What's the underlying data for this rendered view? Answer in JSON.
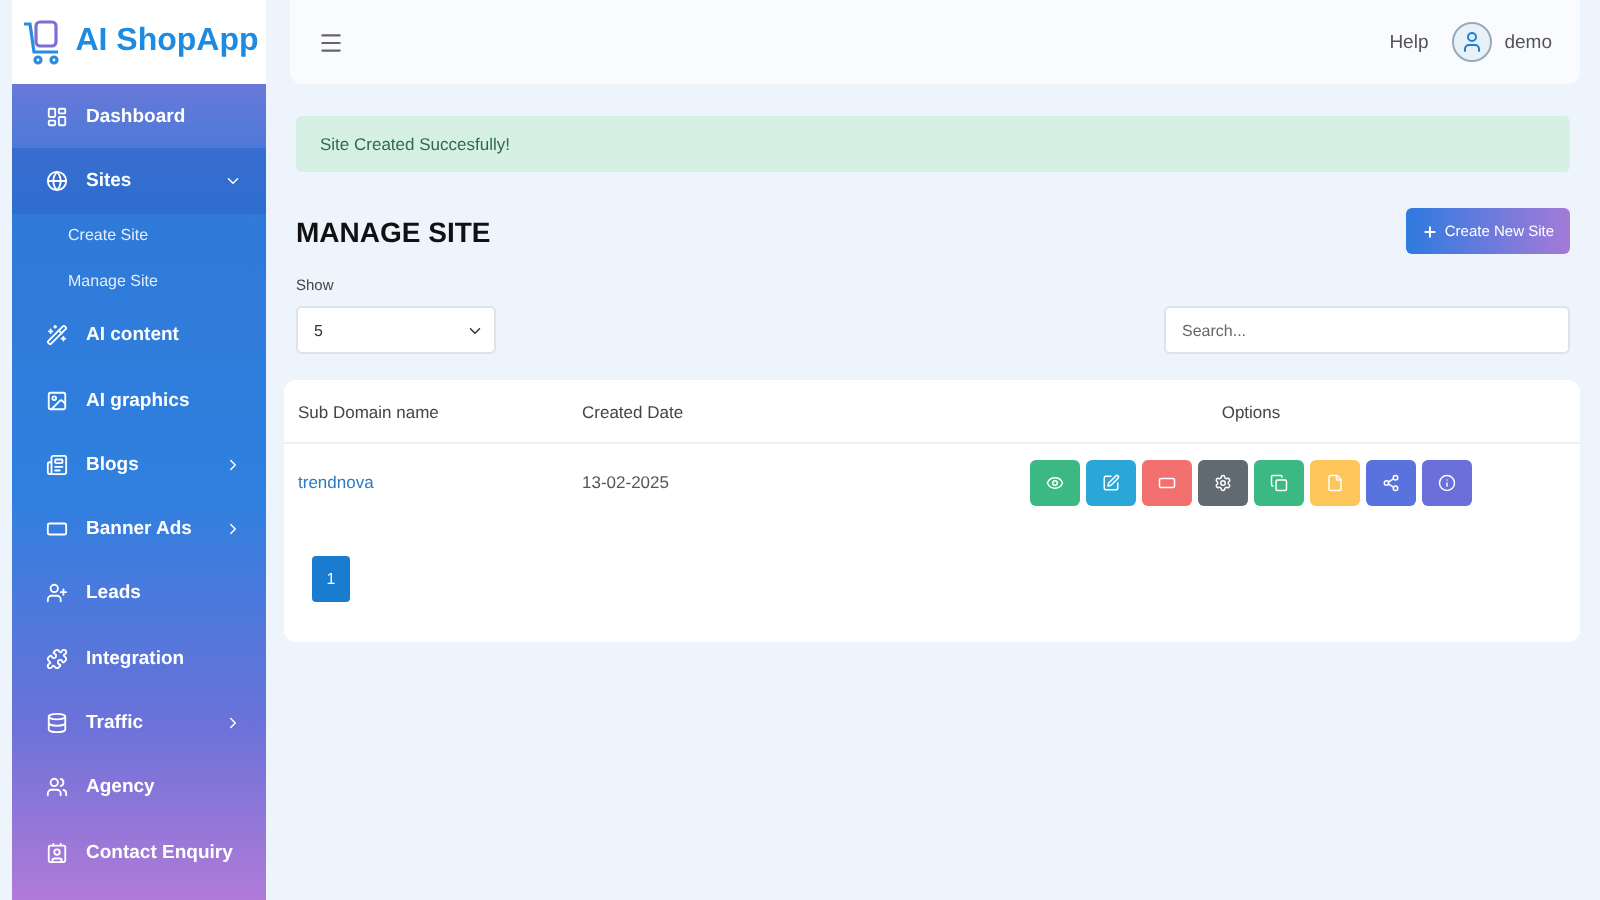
{
  "brand": {
    "name": "AI ShopApp"
  },
  "sidebar": {
    "items": [
      {
        "label": "Dashboard",
        "selected": false
      },
      {
        "label": "Sites",
        "selected": true,
        "expanded": true,
        "children": [
          {
            "label": "Create Site",
            "selected": false
          },
          {
            "label": "Manage Site",
            "selected": false
          }
        ]
      },
      {
        "label": "AI content",
        "selected": false
      },
      {
        "label": "AI graphics",
        "selected": false
      },
      {
        "label": "Blogs",
        "selected": false,
        "expanded": false
      },
      {
        "label": "Banner Ads",
        "selected": false,
        "expanded": false
      },
      {
        "label": "Leads",
        "selected": false
      },
      {
        "label": "Integration",
        "selected": false
      },
      {
        "label": "Traffic",
        "selected": false,
        "expanded": false
      },
      {
        "label": "Agency",
        "selected": false
      },
      {
        "label": "Contact Enquiry",
        "selected": false
      }
    ]
  },
  "topbar": {
    "help": "Help",
    "user": "demo"
  },
  "alert": "Site Created Succesfully!",
  "page_title": "MANAGE SITE",
  "create_button": "Create New Site",
  "show": {
    "label": "Show",
    "value": "5"
  },
  "search": {
    "placeholder": "Search..."
  },
  "table": {
    "columns": [
      "Sub Domain name",
      "Created Date",
      "Options"
    ],
    "rows": [
      {
        "domain": "trendnova",
        "date": "13-02-2025",
        "actions": [
          {
            "kind": "view",
            "color": "#3cb982"
          },
          {
            "kind": "edit",
            "color": "#2aa7d6"
          },
          {
            "kind": "ad",
            "color": "#f2706e"
          },
          {
            "kind": "settings",
            "color": "#616a71"
          },
          {
            "kind": "copy",
            "color": "#3cb982"
          },
          {
            "kind": "file",
            "color": "#fdc55a"
          },
          {
            "kind": "share",
            "color": "#5a72dd"
          },
          {
            "kind": "info",
            "color": "#6a6fd9"
          }
        ]
      }
    ]
  },
  "pagination": [
    {
      "label": "1",
      "selected": true
    }
  ]
}
